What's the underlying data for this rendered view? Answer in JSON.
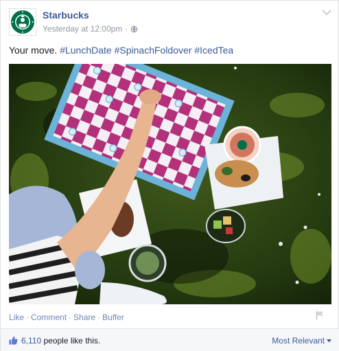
{
  "post": {
    "page_name": "Starbucks",
    "timestamp": "Yesterday at 12:00pm",
    "meta_separator": "·",
    "message_prefix": "Your move.",
    "hashtags": [
      "#LunchDate",
      "#SpinachFoldover",
      "#IcedTea"
    ],
    "avatar_icon": "starbucks-siren-logo-icon",
    "privacy_icon": "globe-icon",
    "menu_icon": "chevron-down-icon",
    "photo_alt": "picnic-photo"
  },
  "actions": {
    "like": "Like",
    "comment": "Comment",
    "share": "Share",
    "buffer": "Buffer",
    "separator": "·",
    "flag_icon": "flag-icon"
  },
  "likes": {
    "count": "6,110",
    "suffix": "people like this.",
    "thumb_icon": "thumbs-up-icon",
    "sort_label": "Most Relevant",
    "sort_icon": "caret-down-icon"
  },
  "colors": {
    "link": "#3b5998",
    "muted": "#9197a3",
    "action_link": "#6d84b4",
    "starbucks_green": "#00704a"
  }
}
